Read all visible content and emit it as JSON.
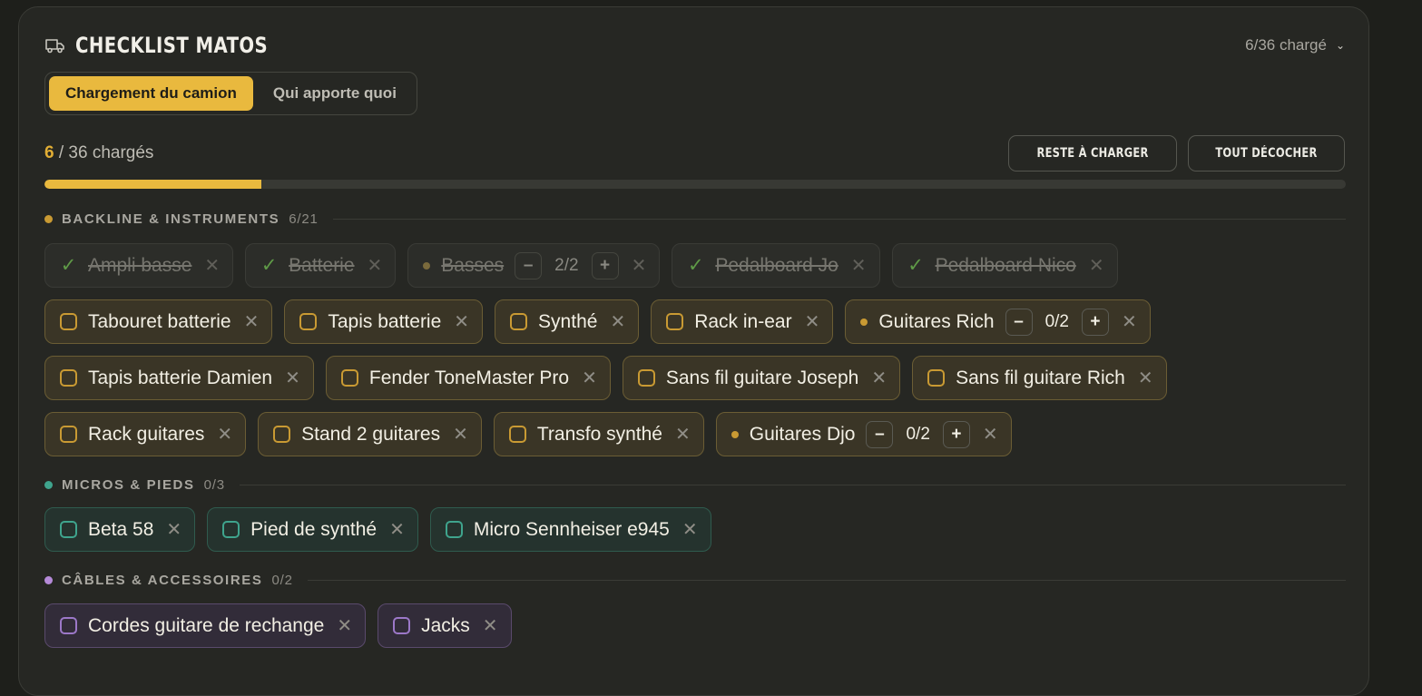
{
  "header": {
    "title": "CHECKLIST MATOS",
    "summary": "6/36 chargé"
  },
  "tabs": [
    {
      "label": "Chargement du camion",
      "active": true
    },
    {
      "label": "Qui apporte quoi",
      "active": false
    }
  ],
  "progress": {
    "loaded": "6",
    "rest": " / 36 chargés",
    "fraction": 0.1667
  },
  "actions": {
    "remaining": "RESTE À CHARGER",
    "uncheck_all": "TOUT DÉCOCHER"
  },
  "colors": {
    "accent": "#e9b93e",
    "backline": "#c99a33",
    "micros": "#3fa48d",
    "cables": "#b58ad8"
  },
  "sections": [
    {
      "label": "BACKLINE & INSTRUMENTS",
      "count": "6/21",
      "rows": [
        [
          {
            "label": "Ampli basse",
            "state": "done"
          },
          {
            "label": "Batterie",
            "state": "done"
          },
          {
            "label": "Basses",
            "state": "done",
            "qty": "2/2"
          },
          {
            "label": "Pedalboard Jo",
            "state": "done"
          },
          {
            "label": "Pedalboard Nico",
            "state": "done"
          }
        ],
        [
          {
            "label": "Tabouret batterie",
            "state": "todo"
          },
          {
            "label": "Tapis batterie",
            "state": "todo"
          },
          {
            "label": "Synthé",
            "state": "todo"
          },
          {
            "label": "Rack in-ear",
            "state": "todo"
          },
          {
            "label": "Guitares Rich",
            "state": "todo",
            "qty": "0/2"
          }
        ],
        [
          {
            "label": "Tapis batterie Damien",
            "state": "todo"
          },
          {
            "label": "Fender ToneMaster Pro",
            "state": "todo"
          },
          {
            "label": "Sans fil guitare Joseph",
            "state": "todo"
          },
          {
            "label": "Sans fil guitare Rich",
            "state": "todo"
          }
        ],
        [
          {
            "label": "Rack guitares",
            "state": "todo"
          },
          {
            "label": "Stand 2 guitares",
            "state": "todo"
          },
          {
            "label": "Transfo synthé",
            "state": "todo"
          },
          {
            "label": "Guitares Djo",
            "state": "todo",
            "qty": "0/2"
          }
        ]
      ]
    },
    {
      "label": "MICROS & PIEDS",
      "count": "0/3",
      "rows": [
        [
          {
            "label": "Beta 58",
            "state": "todo"
          },
          {
            "label": "Pied de synthé",
            "state": "todo"
          },
          {
            "label": "Micro Sennheiser e945",
            "state": "todo"
          }
        ]
      ]
    },
    {
      "label": "CÂBLES & ACCESSOIRES",
      "count": "0/2",
      "rows": [
        [
          {
            "label": "Cordes guitare de rechange",
            "state": "todo"
          },
          {
            "label": "Jacks",
            "state": "todo"
          }
        ]
      ]
    }
  ]
}
